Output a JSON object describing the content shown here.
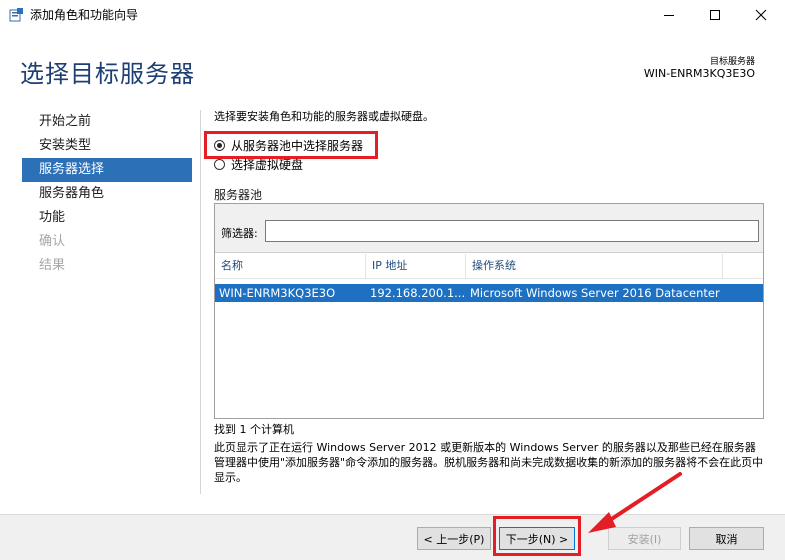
{
  "window": {
    "title": "添加角色和功能向导",
    "minimize_glyph": "─",
    "maximize_glyph": "☐",
    "close_glyph": "✕"
  },
  "header": {
    "page_title": "选择目标服务器",
    "dest_label": "目标服务器",
    "dest_server": "WIN-ENRM3KQ3E3O"
  },
  "nav": {
    "items": [
      {
        "label": "开始之前",
        "state": "normal"
      },
      {
        "label": "安装类型",
        "state": "normal"
      },
      {
        "label": "服务器选择",
        "state": "active"
      },
      {
        "label": "服务器角色",
        "state": "normal"
      },
      {
        "label": "功能",
        "state": "normal"
      },
      {
        "label": "确认",
        "state": "disabled"
      },
      {
        "label": "结果",
        "state": "disabled"
      }
    ]
  },
  "main": {
    "instruction": "选择要安装角色和功能的服务器或虚拟硬盘。",
    "radio_pool": "从服务器池中选择服务器",
    "radio_vhd": "选择虚拟硬盘",
    "pool_label": "服务器池",
    "filter_label": "筛选器:",
    "filter_value": "",
    "columns": [
      "名称",
      "IP 地址",
      "操作系统"
    ],
    "rows": [
      {
        "name": "WIN-ENRM3KQ3E3O",
        "ip": "192.168.200.1...",
        "os": "Microsoft Windows Server 2016 Datacenter"
      }
    ],
    "found": "找到 1 个计算机",
    "description": "此页显示了正在运行 Windows Server 2012 或更新版本的 Windows Server 的服务器以及那些已经在服务器管理器中使用\"添加服务器\"命令添加的服务器。脱机服务器和尚未完成数据收集的新添加的服务器将不会在此页中显示。"
  },
  "footer": {
    "prev_label": "< 上一步(P)",
    "next_label": "下一步(N) >",
    "install_label": "安装(I)",
    "cancel_label": "取消"
  },
  "colors": {
    "accent": "#2c70b8",
    "title_blue": "#1e3f73",
    "highlight_red": "#e31e24",
    "row_selected": "#1d70c2"
  }
}
